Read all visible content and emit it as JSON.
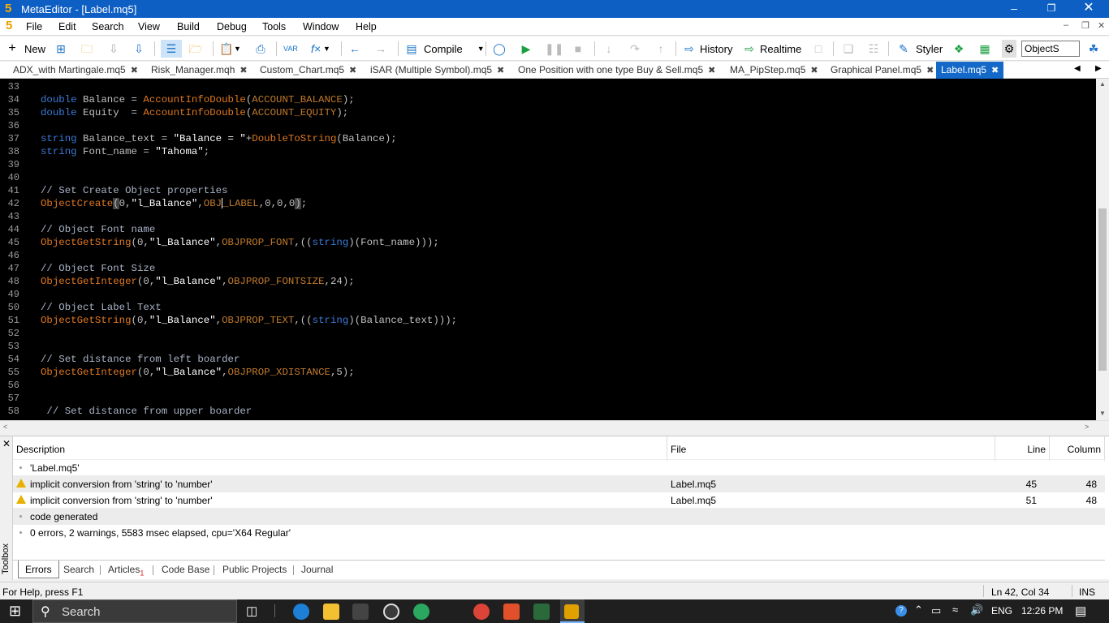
{
  "window": {
    "title": "MetaEditor - [Label.mq5]",
    "logo": "5"
  },
  "menu": [
    "File",
    "Edit",
    "Search",
    "View",
    "Build",
    "Debug",
    "Tools",
    "Window",
    "Help"
  ],
  "toolbar": {
    "new": "New",
    "compile": "Compile",
    "history": "History",
    "realtime": "Realtime",
    "styler": "Styler",
    "search_value": "ObjectS"
  },
  "tabs": [
    "ADX_with Martingale.mq5",
    "Risk_Manager.mqh",
    "Custom_Chart.mq5",
    "iSAR (Multiple Symbol).mq5",
    "One Position with one type Buy & Sell.mq5",
    "MA_PipStep.mq5",
    "Graphical Panel.mq5",
    "Label.mq5"
  ],
  "code": {
    "line_numbers": [
      "33",
      "34",
      "35",
      "36",
      "37",
      "38",
      "39",
      "40",
      "41",
      "42",
      "43",
      "44",
      "45",
      "46",
      "47",
      "48",
      "49",
      "50",
      "51",
      "52",
      "53",
      "54",
      "55",
      "56",
      "57",
      "58"
    ],
    "l34a": "double",
    "l34b": " Balance = ",
    "l34c": "AccountInfoDouble",
    "l34d": "(",
    "l34e": "ACCOUNT_BALANCE",
    "l34f": ");",
    "l35a": "double",
    "l35b": " Equity  = ",
    "l35c": "AccountInfoDouble",
    "l35d": "(",
    "l35e": "ACCOUNT_EQUITY",
    "l35f": ");",
    "l37a": "string",
    "l37b": " Balance_text = ",
    "l37c": "\"Balance = \"",
    "l37d": "+",
    "l37e": "DoubleToString",
    "l37f": "(Balance);",
    "l38a": "string",
    "l38b": " Font_name = ",
    "l38c": "\"Tahoma\"",
    "l38d": ";",
    "l41": "// Set Create Object properties",
    "l42a": "ObjectCreate",
    "l42b": "(",
    "l42c": "0,",
    "l42d": "\"l_Balance\"",
    "l42e": ",",
    "l42f": "OBJ",
    "l42g": "_LABEL",
    "l42h": ",0,0,0",
    "l42i": ")",
    "l42j": ";",
    "l44": "// Object Font name",
    "l45a": "ObjectGetString",
    "l45b": "(0,",
    "l45c": "\"l_Balance\"",
    "l45d": ",",
    "l45e": "OBJPROP_FONT",
    "l45f": ",((",
    "l45g": "string",
    "l45h": ")(Font_name)));",
    "l47": "// Object Font Size",
    "l48a": "ObjectGetInteger",
    "l48b": "(0,",
    "l48c": "\"l_Balance\"",
    "l48d": ",",
    "l48e": "OBJPROP_FONTSIZE",
    "l48f": ",24);",
    "l50": "// Object Label Text",
    "l51a": "ObjectGetString",
    "l51b": "(0,",
    "l51c": "\"l_Balance\"",
    "l51d": ",",
    "l51e": "OBJPROP_TEXT",
    "l51f": ",((",
    "l51g": "string",
    "l51h": ")(Balance_text)));",
    "l54": "// Set distance from left boarder",
    "l55a": "ObjectGetInteger",
    "l55b": "(0,",
    "l55c": "\"l_Balance\"",
    "l55d": ",",
    "l55e": "OBJPROP_XDISTANCE",
    "l55f": ",5);",
    "l58": " // Set distance from upper boarder"
  },
  "toolbox": {
    "headers": {
      "description": "Description",
      "file": "File",
      "line": "Line",
      "column": "Column"
    },
    "rows": [
      {
        "desc": "'Label.mq5'",
        "file": "",
        "line": "",
        "col": ""
      },
      {
        "desc": "implicit conversion from 'string' to 'number'",
        "file": "Label.mq5",
        "line": "45",
        "col": "48"
      },
      {
        "desc": "implicit conversion from 'string' to 'number'",
        "file": "Label.mq5",
        "line": "51",
        "col": "48"
      },
      {
        "desc": "code generated",
        "file": "",
        "line": "",
        "col": ""
      },
      {
        "desc": "0 errors, 2 warnings, 5583 msec elapsed, cpu='X64 Regular'",
        "file": "",
        "line": "",
        "col": ""
      }
    ],
    "side_label": "Toolbox",
    "tabs": [
      "Errors",
      "Search",
      "Articles",
      "Code Base",
      "Public Projects",
      "Journal"
    ],
    "articles_badge": "1"
  },
  "status": {
    "help": "For Help, press F1",
    "position": "Ln 42, Col 34",
    "mode": "INS"
  },
  "taskbar": {
    "search": "Search",
    "lang": "ENG",
    "time": "12:26 PM"
  }
}
